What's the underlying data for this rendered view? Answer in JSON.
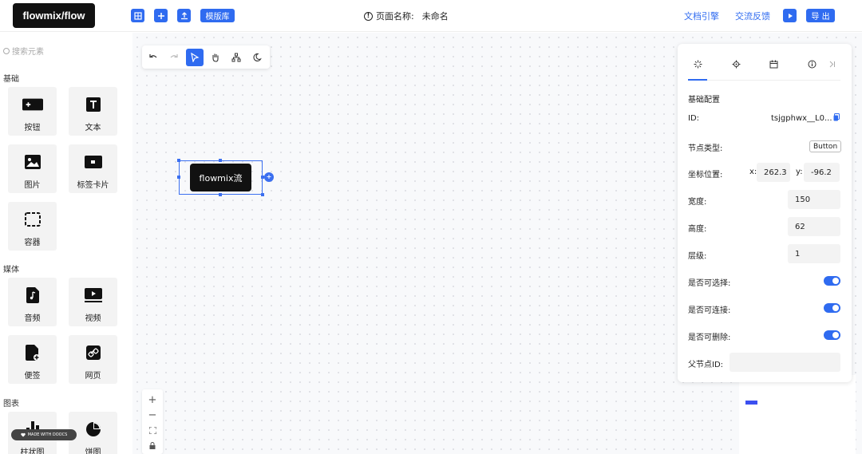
{
  "header": {
    "logo": "flowmix/flow",
    "template_label": "模版库",
    "page_name_label": "页面名称:",
    "page_name_value": "未命名",
    "docs_link": "文档引擎",
    "feedback_link": "交流反馈",
    "export_label": "导 出"
  },
  "sidebar": {
    "search_placeholder": "搜索元素",
    "sections": [
      {
        "title": "基础",
        "items": [
          "按钮",
          "文本",
          "图片",
          "标签卡片",
          "容器"
        ]
      },
      {
        "title": "媒体",
        "items": [
          "音频",
          "视频",
          "便签",
          "网页"
        ]
      },
      {
        "title": "图表",
        "items": [
          "柱状图",
          "饼图"
        ]
      }
    ]
  },
  "canvas": {
    "node_label": "flowmix流",
    "watermark": "MADE WITH DOOCS"
  },
  "panel": {
    "section_title": "基础配置",
    "id_label": "ID:",
    "id_value": "tsjgphwx__L0...",
    "node_type_label": "节点类型:",
    "node_type_value": "Button",
    "position_label": "坐标位置:",
    "x_label": "x:",
    "x_value": "262.3",
    "y_label": "y:",
    "y_value": "-96.2",
    "width_label": "宽度:",
    "width_value": "150",
    "height_label": "高度:",
    "height_value": "62",
    "layer_label": "层级:",
    "layer_value": "1",
    "selectable_label": "是否可选择:",
    "connectable_label": "是否可连接:",
    "deletable_label": "是否可删除:",
    "parent_id_label": "父节点ID:",
    "parent_id_value": ""
  },
  "colors": {
    "accent": "#2f6bf0",
    "logo_bg": "#111111"
  }
}
